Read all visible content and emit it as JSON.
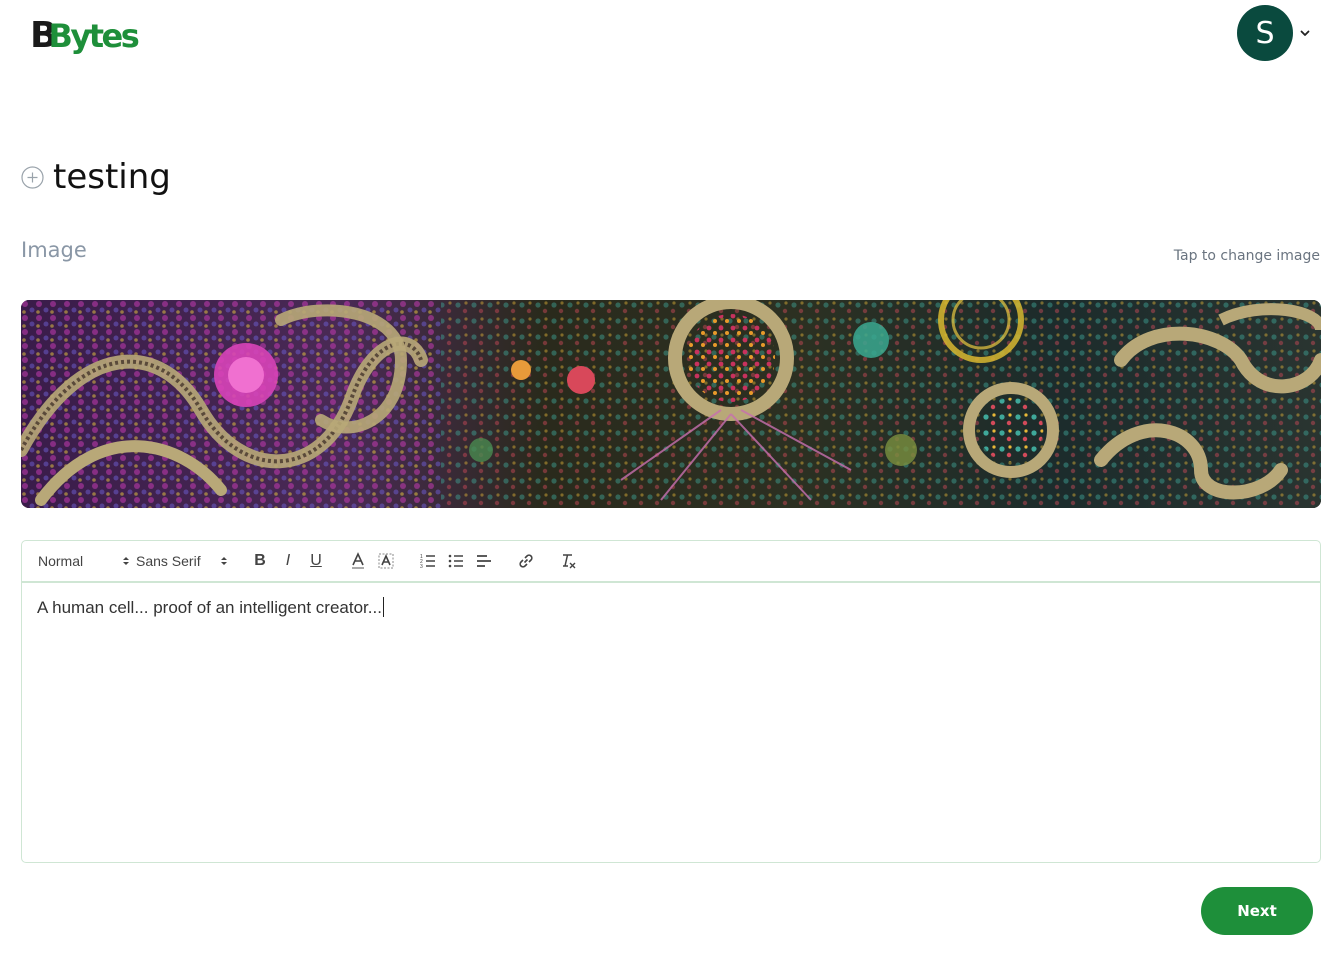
{
  "header": {
    "logo_first": "B",
    "logo_rest": "Bytes",
    "avatar_initial": "S",
    "avatar_color": "#0a4a3e"
  },
  "page": {
    "title": "testing",
    "image_section_label": "Image",
    "change_image_link": "Tap to change image"
  },
  "editor": {
    "format_select": "Normal",
    "font_select": "Sans Serif",
    "toolbar_icons": [
      "bold-icon",
      "italic-icon",
      "underline-icon",
      "text-color-icon",
      "background-color-icon",
      "ordered-list-icon",
      "bullet-list-icon",
      "align-icon",
      "link-icon",
      "clear-format-icon"
    ],
    "toolbar_labels": {
      "bold": "B",
      "italic": "I",
      "underline": "U"
    },
    "content": "A human cell... proof of an intelligent creator..."
  },
  "actions": {
    "next_label": "Next"
  },
  "colors": {
    "brand_green": "#1e8f3a",
    "editor_border": "#cfe6d4",
    "label_gray": "#8a97a6"
  }
}
